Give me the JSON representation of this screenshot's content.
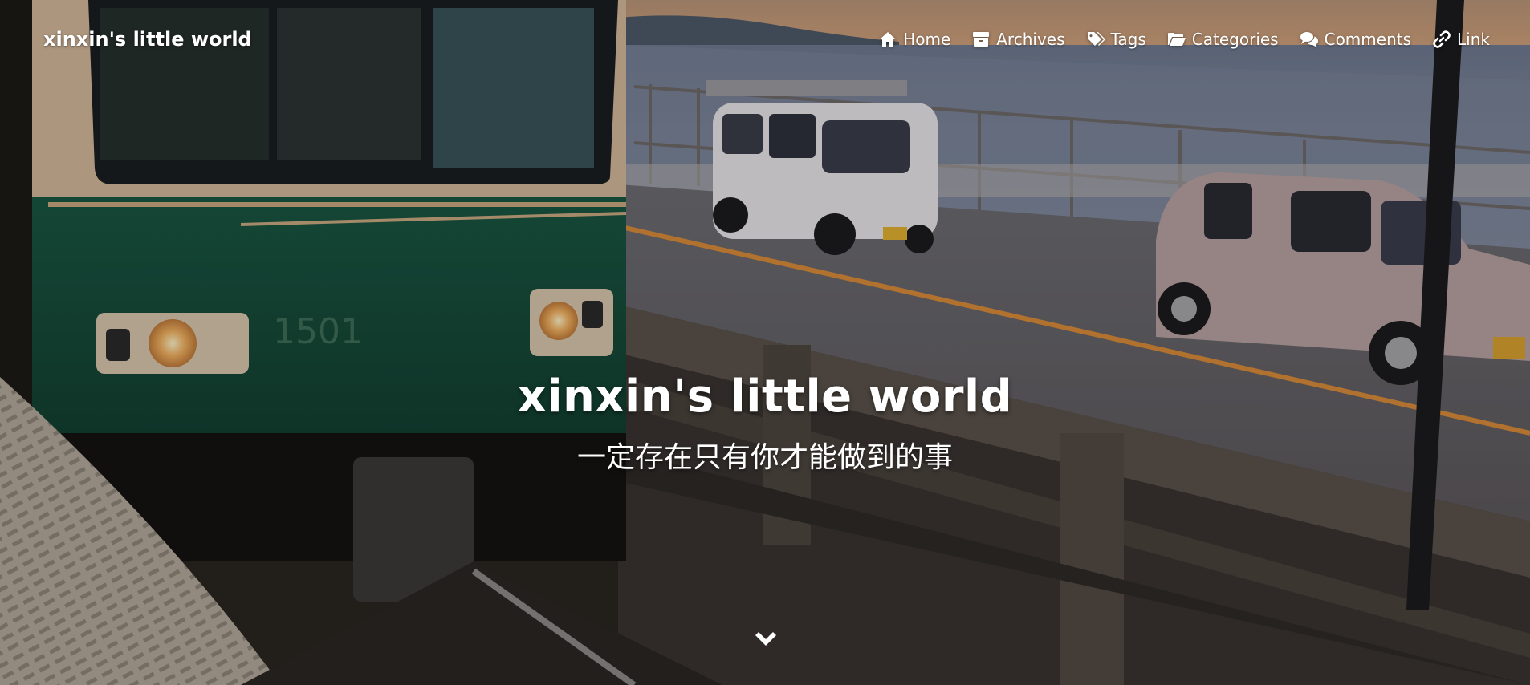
{
  "navbar": {
    "brand": "xinxin's little world",
    "menu": [
      {
        "label": "Home",
        "icon": "home-icon"
      },
      {
        "label": "Archives",
        "icon": "archive-icon"
      },
      {
        "label": "Tags",
        "icon": "tags-icon"
      },
      {
        "label": "Categories",
        "icon": "folder-open-icon"
      },
      {
        "label": "Comments",
        "icon": "comments-icon"
      },
      {
        "label": "Link",
        "icon": "link-icon"
      }
    ]
  },
  "hero": {
    "title": "xinxin's little world",
    "subtitle": "一定存在只有你才能做到的事",
    "scroll_icon": "chevron-down-icon"
  },
  "colors": {
    "text": "#ffffff",
    "train_green": "#1d5a45",
    "sky_sunset": "#c49a72",
    "sea": "#7f8aa0"
  }
}
